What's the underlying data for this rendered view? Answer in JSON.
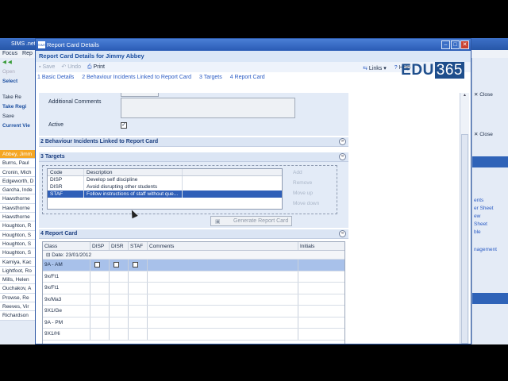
{
  "bg_app": {
    "title": "SIMS .net",
    "menu_focus": "Focus",
    "menu_rep": "Rep",
    "open": "Open",
    "select": "Select",
    "take_reg": "Take Re",
    "take_regi": "Take Regi",
    "save": "Save",
    "current_view": "Current Vie",
    "students": [
      "Abbey, Jimm",
      "Burns, Paul",
      "Cronin, Mich",
      "Edgeworth, D",
      "Garcha, Inde",
      "Hawsthorne",
      "Hawsthorne",
      "Hawsthorne",
      "Houghton, R",
      "Houghton, S",
      "Houghton, S",
      "Houghton, S",
      "Kamiya, Kac",
      "Lightfoot, Ro",
      "Mills, Helen",
      "Ouchakov, A",
      "Prowse, Re",
      "Reeves, Vir",
      "Richardson"
    ],
    "right_close_1": "Close",
    "right_close_2": "Close",
    "right_links": [
      "ents",
      "er Sheet",
      "ew",
      "Sheet",
      "ble",
      "nagement"
    ]
  },
  "dialog": {
    "title": "Report Card Details",
    "subtitle": "Report Card Details for Jimmy Abbey",
    "toolbar": {
      "save": "Save",
      "undo": "Undo",
      "print": "Print"
    },
    "nav": [
      "1 Basic Details",
      "2 Behaviour Incidents Linked to Report Card",
      "3 Targets",
      "4 Report Card"
    ],
    "links": "Links",
    "help": "Help",
    "logo_text": "EDU",
    "logo_num": "365"
  },
  "basic": {
    "additional_comments_label": "Additional Comments",
    "active_label": "Active",
    "active_checked": "✓"
  },
  "section2": {
    "title": "2 Behaviour Incidents Linked to Report Card"
  },
  "targets": {
    "title": "3 Targets",
    "columns": [
      "Code",
      "Description"
    ],
    "rows": [
      {
        "code": "DISP",
        "desc": "Develop self discipline"
      },
      {
        "code": "DISR",
        "desc": "Avoid disrupting other students"
      },
      {
        "code": "STAF",
        "desc": "Follow instructions of staff without que..."
      }
    ],
    "side_buttons": [
      "Add",
      "Remove",
      "Move up",
      "Move down"
    ],
    "generate": "Generate Report Card"
  },
  "report_card": {
    "title": "4 Report Card",
    "columns": [
      "Class",
      "DISP",
      "DISR",
      "STAF",
      "Comments",
      "Initials"
    ],
    "date_label": "Date: 23/01/2012",
    "rows": [
      "9A - AM",
      "9x/Ft1",
      "9x/Ft1",
      "9x/Ma3",
      "9X1/Ge",
      "9A - PM",
      "9X1/Hi"
    ]
  },
  "colors": {
    "accent": "#2a5bb5",
    "selected_student": "#f5a623",
    "selected_row": "#2f5fb8"
  }
}
